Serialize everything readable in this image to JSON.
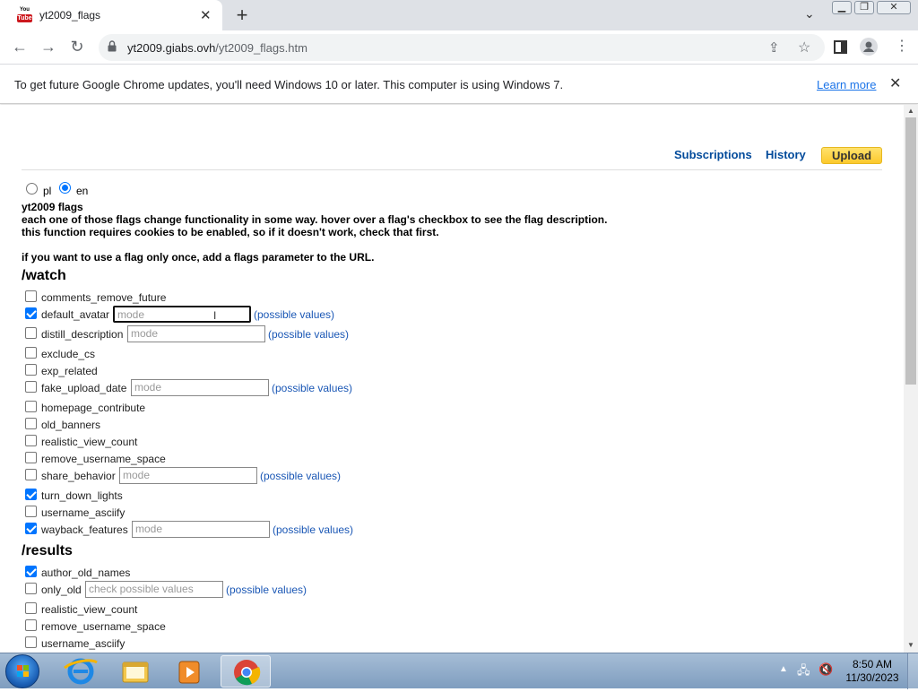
{
  "browser": {
    "tab_title": "yt2009_flags",
    "tab_favicon_text": "You",
    "tab_favicon_badge": "Tube",
    "url_host": "yt2009.giabs.ovh",
    "url_path": "/yt2009_flags.htm",
    "icons": [
      "back-icon",
      "forward-icon",
      "reload-icon",
      "lock-icon",
      "share-icon",
      "star-icon",
      "sidepanel-icon",
      "profile-icon",
      "menu-icon"
    ]
  },
  "infobar": {
    "message": "To get future Google Chrome updates, you'll need Windows 10 or later. This computer is using Windows 7.",
    "learn_more": "Learn more"
  },
  "header": {
    "subscriptions": "Subscriptions",
    "history": "History",
    "upload": "Upload"
  },
  "lang": {
    "pl": "pl",
    "en": "en",
    "selected": "en"
  },
  "intro": {
    "title": "yt2009 flags",
    "line1": "each one of those flags change functionality in some way. hover over a flag's checkbox to see the flag description.",
    "line2": "this function requires cookies to be enabled, so if it doesn't work, check that first.",
    "line3": "if you want to use a flag only once, add a flags parameter to the URL."
  },
  "watch": {
    "heading": "/watch",
    "flags": [
      {
        "name": "comments_remove_future",
        "checked": false
      },
      {
        "name": "default_avatar",
        "checked": true,
        "placeholder": "mode",
        "link": "(possible values)"
      },
      {
        "name": "distill_description",
        "checked": false,
        "placeholder": "mode",
        "link": "(possible values)"
      },
      {
        "name": "exclude_cs",
        "checked": false
      },
      {
        "name": "exp_related",
        "checked": false
      },
      {
        "name": "fake_upload_date",
        "checked": false,
        "placeholder": "mode",
        "link": "(possible values)"
      },
      {
        "name": "homepage_contribute",
        "checked": false
      },
      {
        "name": "old_banners",
        "checked": false
      },
      {
        "name": "realistic_view_count",
        "checked": false
      },
      {
        "name": "remove_username_space",
        "checked": false
      },
      {
        "name": "share_behavior",
        "checked": false,
        "placeholder": "mode",
        "link": "(possible values)"
      },
      {
        "name": "turn_down_lights",
        "checked": true
      },
      {
        "name": "username_asciify",
        "checked": false
      },
      {
        "name": "wayback_features",
        "checked": true,
        "placeholder": "mode",
        "link": "(possible values)"
      }
    ]
  },
  "results": {
    "heading": "/results",
    "flags": [
      {
        "name": "author_old_names",
        "checked": true
      },
      {
        "name": "only_old",
        "checked": false,
        "placeholder": "check possible values",
        "link": "(possible values)"
      },
      {
        "name": "realistic_view_count",
        "checked": false
      },
      {
        "name": "remove_username_space",
        "checked": false
      },
      {
        "name": "username_asciify",
        "checked": false
      }
    ]
  },
  "taskbar": {
    "time": "8:50 AM",
    "date": "11/30/2023",
    "apps": [
      "internet-explorer-icon",
      "file-explorer-icon",
      "media-player-icon",
      "chrome-icon"
    ],
    "active_app": "chrome-icon"
  },
  "colors": {
    "accent": "#0075ff",
    "link": "#034b9b",
    "upload": "#fcc92c"
  }
}
